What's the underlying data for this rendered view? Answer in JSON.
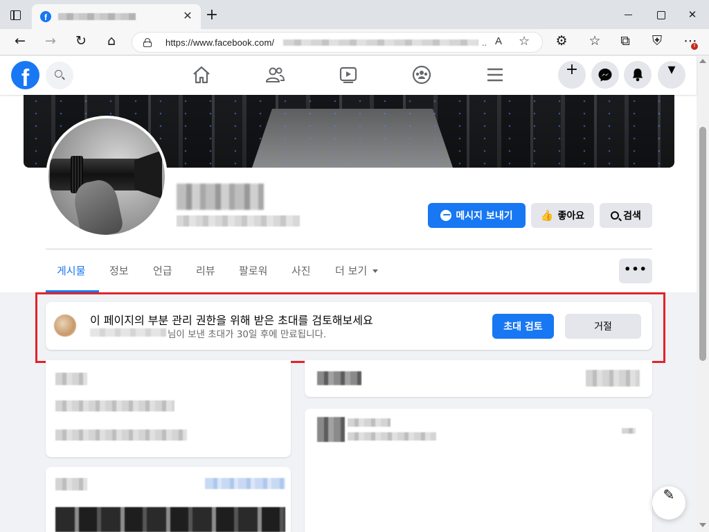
{
  "browser": {
    "url_visible": "https://www.facebook.com/",
    "url_truncated_mark": "..",
    "tab_close_glyph": "✕",
    "new_tab_glyph": "+",
    "window_close_glyph": "✕",
    "back_glyph": "←",
    "forward_glyph": "→",
    "reload_glyph": "↻",
    "home_glyph": "⌂",
    "read_aloud_glyph": "A",
    "favorite_add_glyph": "☆",
    "extensions_glyph": "⚙",
    "favorites_glyph": "☆",
    "collections_glyph": "⧉",
    "shield_glyph": "⛨",
    "more_glyph": "⋯",
    "more_badge": "!",
    "icons": [
      "tab-actions-icon",
      "back-icon",
      "forward-icon",
      "refresh-icon",
      "home-icon",
      "lock-icon",
      "read-aloud-icon",
      "add-favorite-icon",
      "extensions-icon",
      "favorites-icon",
      "collections-icon",
      "browser-essentials-icon",
      "settings-more-icon"
    ]
  },
  "fb_nav": {
    "logo": "f",
    "create_glyph": "+",
    "account_glyph": "▾",
    "icons": [
      "facebook-logo",
      "search-icon",
      "home-icon",
      "friends-icon",
      "watch-icon",
      "groups-icon",
      "menu-icon",
      "create-icon",
      "messenger-icon",
      "notifications-icon",
      "account-icon"
    ]
  },
  "page_header": {
    "buttons": {
      "message": "메시지 보내기",
      "like": "좋아요",
      "search": "검색"
    },
    "like_glyph": "👍",
    "tabs": [
      "게시물",
      "정보",
      "언급",
      "리뷰",
      "팔로워",
      "사진",
      "더 보기"
    ],
    "active_tab": "게시물",
    "more_options": "•••"
  },
  "invite": {
    "title": "이 페이지의 부분 관리 권한을 위해 받은 초대를 검토해보세요",
    "subtitle": "님이 보낸 초대가 30일 후에 만료됩니다.",
    "review_button": "초대 검토",
    "decline_button": "거절"
  },
  "compose_glyph": "✎",
  "colors": {
    "facebook_blue": "#1877f2",
    "page_background": "#f0f2f5",
    "highlight_red": "#e0242a",
    "secondary_text": "#65676b",
    "button_gray": "#e4e6eb"
  }
}
